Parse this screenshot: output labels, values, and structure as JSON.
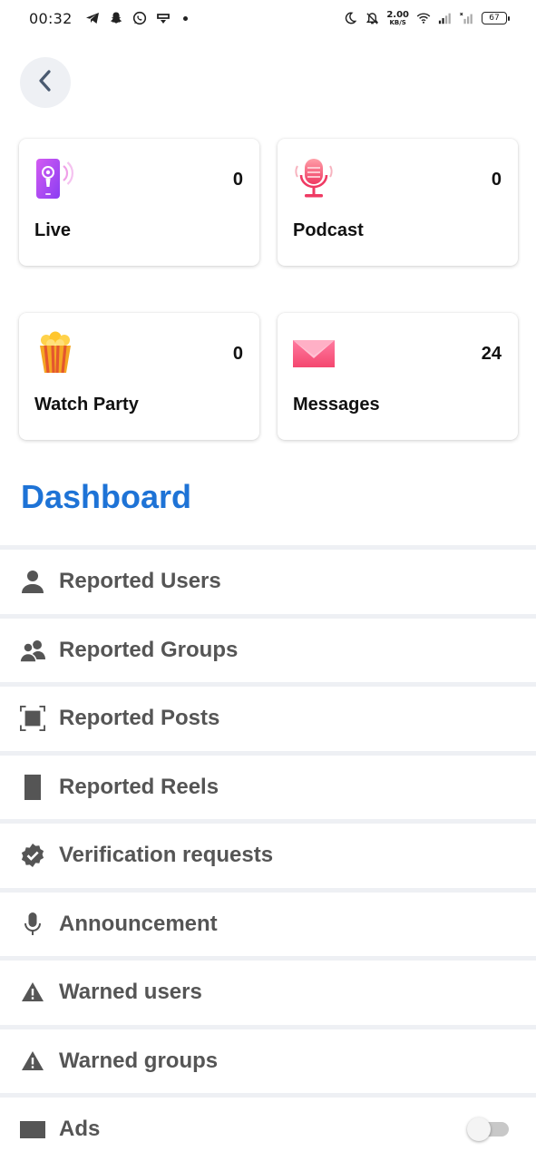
{
  "status_bar": {
    "time": "00:32",
    "net_speed_value": "2.00",
    "net_speed_unit": "KB/S",
    "battery": "67"
  },
  "cards": [
    {
      "label": "Live",
      "count": "0",
      "icon": "live-phone-icon"
    },
    {
      "label": "Podcast",
      "count": "0",
      "icon": "microphone-icon"
    },
    {
      "label": "Watch Party",
      "count": "0",
      "icon": "popcorn-icon"
    },
    {
      "label": "Messages",
      "count": "24",
      "icon": "envelope-icon"
    }
  ],
  "dashboard": {
    "title": "Dashboard",
    "items": [
      {
        "label": "Reported Users",
        "icon": "person-icon"
      },
      {
        "label": "Reported Groups",
        "icon": "people-icon"
      },
      {
        "label": "Reported Posts",
        "icon": "square-frame-icon"
      },
      {
        "label": "Reported Reels",
        "icon": "reel-icon"
      },
      {
        "label": "Verification requests",
        "icon": "verified-badge-icon"
      },
      {
        "label": "Announcement",
        "icon": "microphone-icon"
      },
      {
        "label": "Warned users",
        "icon": "warning-icon"
      },
      {
        "label": "Warned groups",
        "icon": "warning-icon"
      },
      {
        "label": "Ads",
        "icon": "ad-icon",
        "toggle_on": false
      }
    ]
  },
  "colors": {
    "accent": "#1e73d6",
    "menu_text": "#555555",
    "divider": "#eef0f4"
  }
}
